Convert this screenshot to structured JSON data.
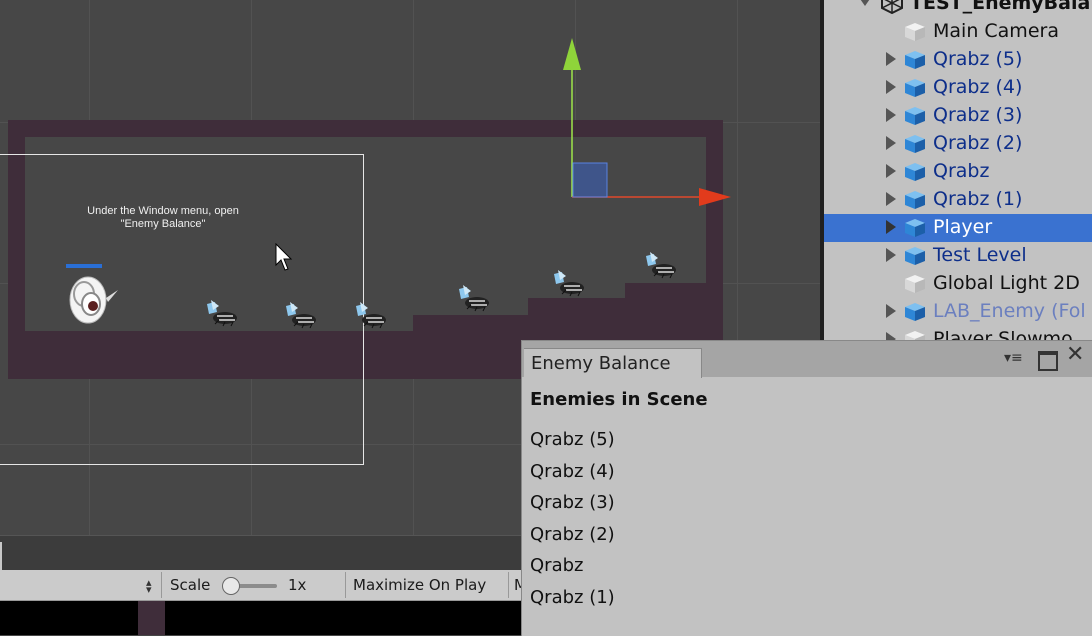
{
  "scene": {
    "hint_line1": "Under the Window menu, open",
    "hint_line2": "\"Enemy Balance\""
  },
  "hierarchy": {
    "scene_name": "TEST_EnemyBala",
    "items": [
      {
        "label": "Main Camera",
        "expandable": false,
        "color": "black"
      },
      {
        "label": "Qrabz (5)",
        "expandable": true,
        "color": "blue"
      },
      {
        "label": "Qrabz (4)",
        "expandable": true,
        "color": "blue"
      },
      {
        "label": "Qrabz (3)",
        "expandable": true,
        "color": "blue"
      },
      {
        "label": "Qrabz (2)",
        "expandable": true,
        "color": "blue"
      },
      {
        "label": "Qrabz",
        "expandable": true,
        "color": "blue"
      },
      {
        "label": "Qrabz (1)",
        "expandable": true,
        "color": "blue"
      },
      {
        "label": "Player",
        "expandable": true,
        "color": "white",
        "selected": true
      },
      {
        "label": "Test Level",
        "expandable": true,
        "color": "blue"
      },
      {
        "label": "Global Light 2D",
        "expandable": false,
        "color": "black"
      },
      {
        "label": "LAB_Enemy (Fol",
        "expandable": true,
        "color": "faded"
      },
      {
        "label": "Player Slowmo",
        "expandable": true,
        "color": "black"
      }
    ]
  },
  "enemy_balance": {
    "tab_title": "Enemy Balance",
    "heading": "Enemies in Scene",
    "enemies": [
      "Qrabz (5)",
      "Qrabz (4)",
      "Qrabz (3)",
      "Qrabz (2)",
      "Qrabz",
      "Qrabz (1)"
    ]
  },
  "game_toolbar": {
    "scale_label": "Scale",
    "scale_value": "1x",
    "maximize_label": "Maximize On Play",
    "trailing_label": "M"
  },
  "colors": {
    "selection": "#3a72d0",
    "prefab_blue": "#0d2e8a",
    "level": "#3f2d3a",
    "scene_bg": "#474747"
  }
}
